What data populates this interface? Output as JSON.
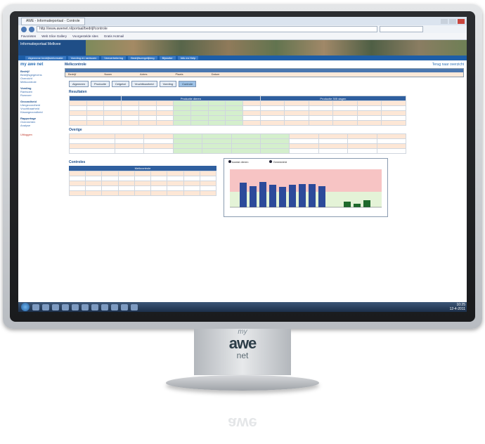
{
  "browser": {
    "tab_title": "AWE - Informatieportaal - Controle",
    "url": "http://www.awenet.nl/portaal/bedrijf/controle",
    "favorites": [
      "Favorieten",
      "Web Slice Gallery",
      "Voorgestelde sites",
      "Gratis Hotmail"
    ]
  },
  "portal": {
    "brand": "Informatieportaal Melkvee",
    "nav": [
      "Algemene bedrijfsinformatie",
      "Voeding en rantsoen",
      "Veeverbetering",
      "Bedrijfsvergelijking",
      "Bijsluiter",
      "Info en Help"
    ]
  },
  "leftnav": {
    "sections": [
      {
        "title": "Bedrijf",
        "items": [
          "Bedrijfsgegevens",
          "Overzicht",
          "Melkcontrole"
        ]
      },
      {
        "title": "Voeding",
        "items": [
          "Rantsoen",
          "Ruwvoer"
        ]
      },
      {
        "title": "Gezondheid",
        "items": [
          "Uiergezondheid",
          "Vruchtbaarheid",
          "Klauwgezondheid"
        ]
      },
      {
        "title": "Rapportage",
        "items": [
          "Overzichten",
          "Analyse"
        ]
      }
    ],
    "logout": "Uitloggen"
  },
  "main": {
    "heading": "Melkcontrole",
    "link_right": "Terug naar overzicht",
    "info_cols": [
      "Bedrijf",
      "Naam",
      "Adres",
      "Plaats",
      "Datum"
    ],
    "tabs": [
      "Algemeen",
      "Productie",
      "Celgetal",
      "Vruchtbaarheid",
      "Voeding",
      "Controle"
    ],
    "active_tab": "Controle",
    "section1_title": "Resultaten",
    "grid_header_left": "Productie dieren",
    "grid_header_right": "Productie 305 dagen",
    "section2_title": "Overige",
    "ctrl_title": "Controles",
    "ctrl_subtitle": "Melkcontrole",
    "chart_legend": [
      "Aantal dieren",
      "Gemiddeld"
    ]
  },
  "taskbar": {
    "time": "10:25",
    "date": "12-4-2011"
  },
  "monitor_logo": {
    "line1": "my",
    "line2": "awe",
    "line3": "net"
  }
}
